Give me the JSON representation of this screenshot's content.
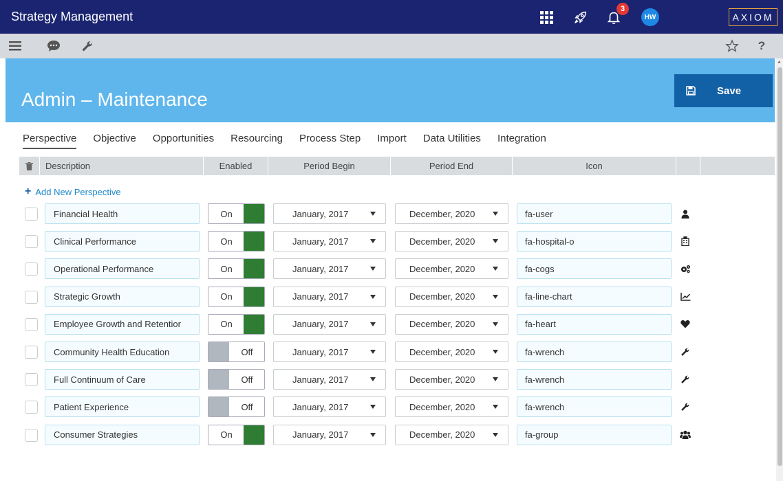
{
  "app": {
    "title": "Strategy Management",
    "bell_count": "3",
    "avatar_initials": "HW",
    "brand": "AXIOM"
  },
  "topbar_icons": [
    "grid-icon",
    "rocket-icon",
    "bell-icon"
  ],
  "toolbar_icons": [
    "menu-icon",
    "chat-icon",
    "wrench-icon",
    "star-icon",
    "help-icon"
  ],
  "help_glyph": "?",
  "page": {
    "title": "Admin – Maintenance",
    "save_label": "Save"
  },
  "tabs": [
    {
      "label": "Perspective",
      "active": true
    },
    {
      "label": "Objective"
    },
    {
      "label": "Opportunities"
    },
    {
      "label": "Resourcing"
    },
    {
      "label": "Process Step"
    },
    {
      "label": "Import"
    },
    {
      "label": "Data Utilities"
    },
    {
      "label": "Integration"
    }
  ],
  "table": {
    "headers": {
      "description": "Description",
      "enabled": "Enabled",
      "period_begin": "Period Begin",
      "period_end": "Period End",
      "icon": "Icon"
    },
    "add_label": "Add New Perspective",
    "rows": [
      {
        "description": "Financial Health",
        "enabled": "On",
        "begin": "January, 2017",
        "end": "December, 2020",
        "icon": "fa-user",
        "icon_name": "user-icon"
      },
      {
        "description": "Clinical Performance",
        "enabled": "On",
        "begin": "January, 2017",
        "end": "December, 2020",
        "icon": "fa-hospital-o",
        "icon_name": "hospital-icon"
      },
      {
        "description": "Operational Performance",
        "enabled": "On",
        "begin": "January, 2017",
        "end": "December, 2020",
        "icon": "fa-cogs",
        "icon_name": "cogs-icon"
      },
      {
        "description": "Strategic Growth",
        "enabled": "On",
        "begin": "January, 2017",
        "end": "December, 2020",
        "icon": "fa-line-chart",
        "icon_name": "line-chart-icon"
      },
      {
        "description": "Employee Growth and Retentior",
        "enabled": "On",
        "begin": "January, 2017",
        "end": "December, 2020",
        "icon": "fa-heart",
        "icon_name": "heart-icon"
      },
      {
        "description": "Community Health Education",
        "enabled": "Off",
        "begin": "January, 2017",
        "end": "December, 2020",
        "icon": "fa-wrench",
        "icon_name": "wrench-icon"
      },
      {
        "description": "Full Continuum of Care",
        "enabled": "Off",
        "begin": "January, 2017",
        "end": "December, 2020",
        "icon": "fa-wrench",
        "icon_name": "wrench-icon"
      },
      {
        "description": "Patient Experience",
        "enabled": "Off",
        "begin": "January, 2017",
        "end": "December, 2020",
        "icon": "fa-wrench",
        "icon_name": "wrench-icon"
      },
      {
        "description": "Consumer Strategies",
        "enabled": "On",
        "begin": "January, 2017",
        "end": "December, 2020",
        "icon": "fa-group",
        "icon_name": "group-icon"
      }
    ]
  },
  "colors": {
    "topbar": "#1a2470",
    "header": "#5eb6ec",
    "save": "#1260a5",
    "toggle_on": "#2e7d32",
    "toggle_off": "#b0b7bf",
    "link": "#1e88c8"
  }
}
